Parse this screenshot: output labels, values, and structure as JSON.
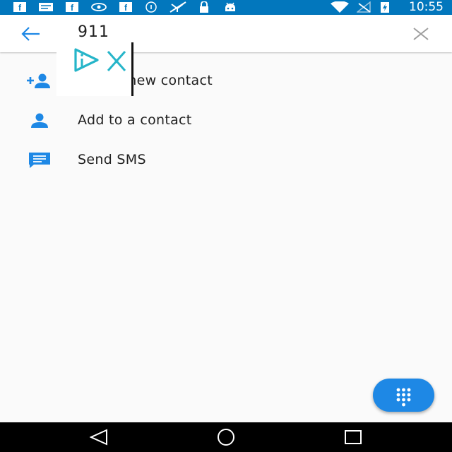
{
  "status_bar": {
    "time": "10:55",
    "icons": [
      "facebook-icon",
      "message-icon",
      "facebook-icon",
      "eye-icon",
      "facebook-icon",
      "info-icon",
      "no-location-icon",
      "lock-icon",
      "android-icon",
      "wifi-icon",
      "no-signal-icon",
      "battery-charging-icon"
    ]
  },
  "search": {
    "query": "911"
  },
  "actions": [
    {
      "label": "Create new contact",
      "icon": "add-person-icon"
    },
    {
      "label": "Add to a contact",
      "icon": "person-icon"
    },
    {
      "label": "Send SMS",
      "icon": "message-icon"
    }
  ],
  "colors": {
    "status_bar": "#0277bd",
    "accent": "#1e88e5",
    "overlay_teal": "#26b5c9"
  },
  "fab": {
    "icon": "dialpad-icon"
  },
  "nav_bar": {
    "icons": [
      "back-triangle-icon",
      "home-circle-icon",
      "recents-square-icon"
    ]
  }
}
